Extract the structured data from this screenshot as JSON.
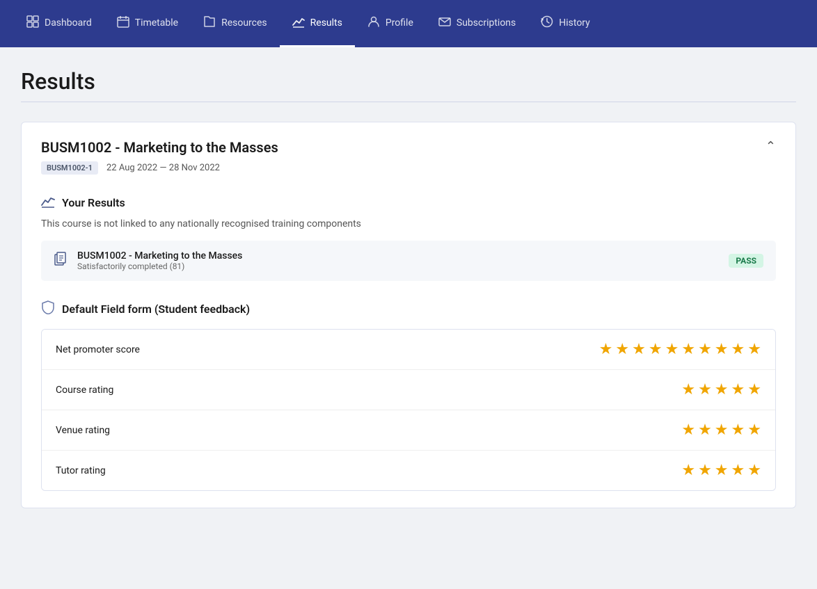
{
  "nav": {
    "items": [
      {
        "id": "dashboard",
        "label": "Dashboard",
        "icon": "⊞",
        "active": false
      },
      {
        "id": "timetable",
        "label": "Timetable",
        "icon": "📅",
        "active": false
      },
      {
        "id": "resources",
        "label": "Resources",
        "icon": "📁",
        "active": false
      },
      {
        "id": "results",
        "label": "Results",
        "icon": "📊",
        "active": true
      },
      {
        "id": "profile",
        "label": "Profile",
        "icon": "👤",
        "active": false
      },
      {
        "id": "subscriptions",
        "label": "Subscriptions",
        "icon": "✉",
        "active": false
      },
      {
        "id": "history",
        "label": "History",
        "icon": "🕐",
        "active": false
      }
    ]
  },
  "page": {
    "title": "Results"
  },
  "course": {
    "title": "BUSM1002 - Marketing to the Masses",
    "code": "BUSM1002-1",
    "dates": "22 Aug 2022 — 28 Nov 2022",
    "results_heading": "Your Results",
    "not_linked_text": "This course is not linked to any nationally recognised training components",
    "result_name": "BUSM1002 - Marketing to the Masses",
    "result_status": "Satisfactorily completed (81)",
    "pass_label": "PASS"
  },
  "feedback": {
    "heading": "Default Field form (Student feedback)",
    "rows": [
      {
        "label": "Net promoter score",
        "stars": 10
      },
      {
        "label": "Course rating",
        "stars": 5
      },
      {
        "label": "Venue rating",
        "stars": 5
      },
      {
        "label": "Tutor rating",
        "stars": 5
      }
    ]
  }
}
